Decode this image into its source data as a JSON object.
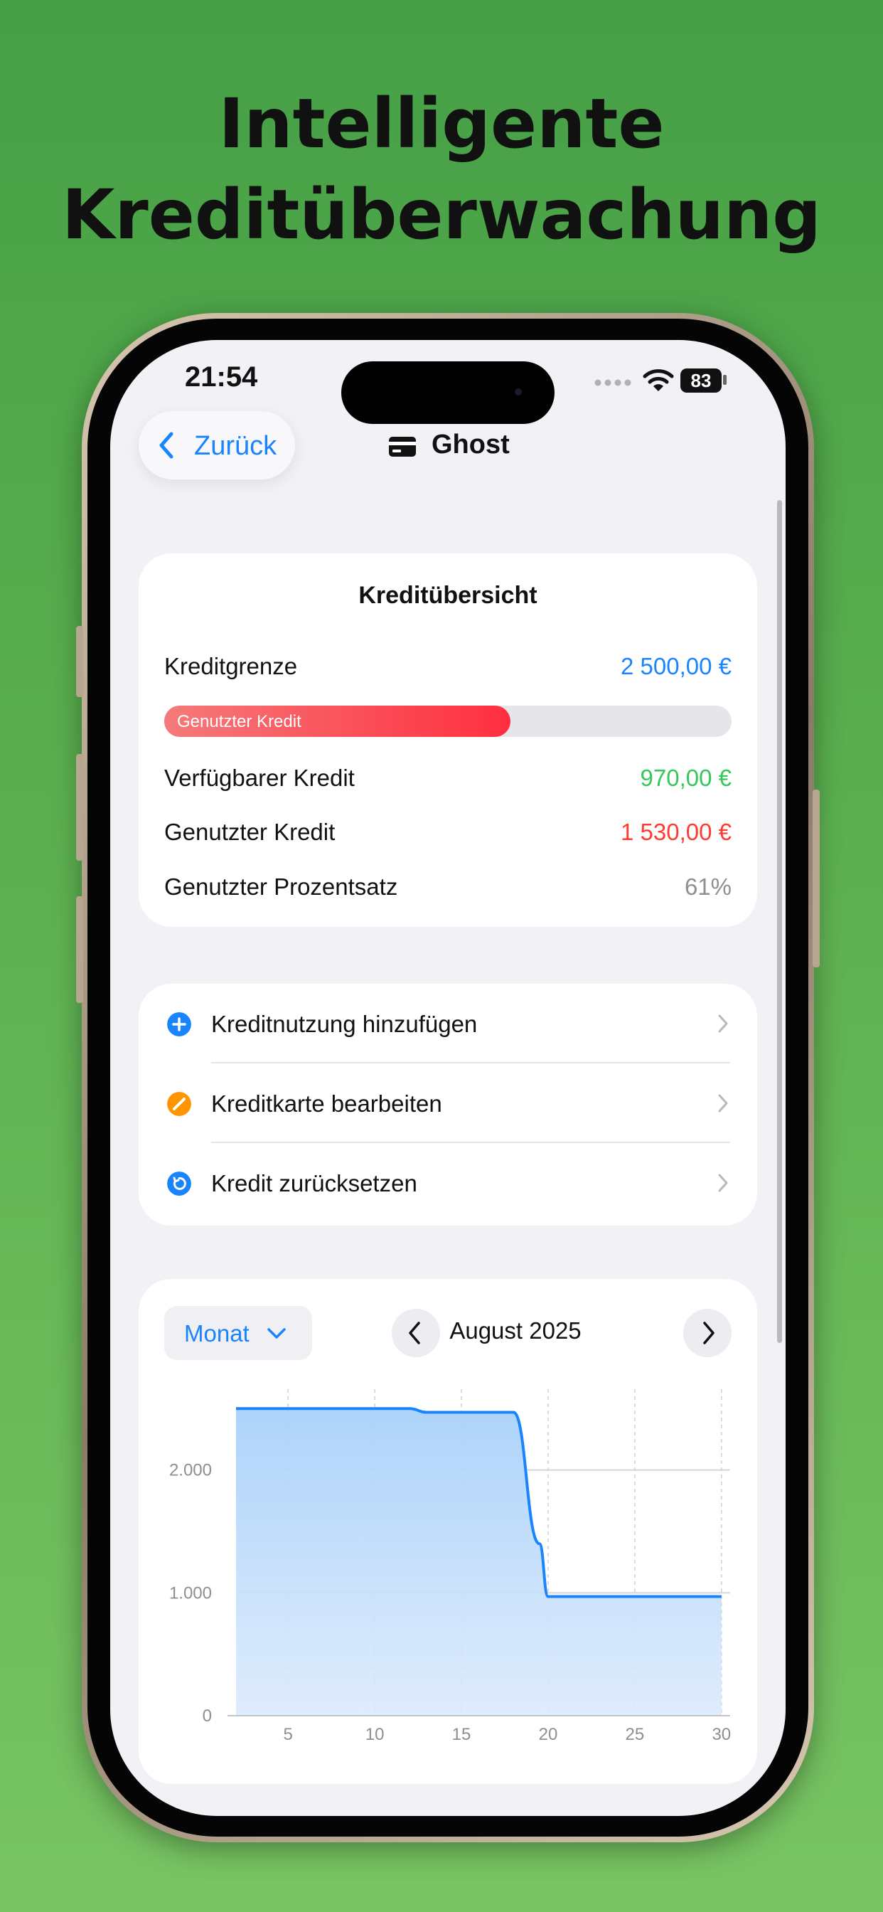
{
  "headline": [
    "Intelligente",
    "Kreditüberwachung"
  ],
  "status_bar": {
    "time": "21:54",
    "battery": "83"
  },
  "nav": {
    "back_label": "Zurück",
    "title": "Ghost",
    "title_icon": "credit-card-icon"
  },
  "overview": {
    "title": "Kreditübersicht",
    "credit_limit_label": "Kreditgrenze",
    "credit_limit_value": "2 500,00 €",
    "usage_bar_label": "Genutzter Kredit",
    "usage_fraction": 0.61,
    "available_label": "Verfügbarer Kredit",
    "available_value": "970,00 €",
    "used_label": "Genutzter Kredit",
    "used_value": "1 530,00 €",
    "percent_label": "Genutzter Prozentsatz",
    "percent_value": "61%"
  },
  "actions": [
    {
      "label": "Kreditnutzung hinzufügen",
      "icon": "plus-circle-icon",
      "color": "#1a84ff"
    },
    {
      "label": "Kreditkarte bearbeiten",
      "icon": "pencil-circle-icon",
      "color": "#ff9500"
    },
    {
      "label": "Kredit zurücksetzen",
      "icon": "reset-circle-icon",
      "color": "#1a84ff"
    }
  ],
  "chart_controls": {
    "period_label": "Monat",
    "month_label": "August 2025"
  },
  "colors": {
    "accent": "#1a84ff",
    "positive": "#34c759",
    "negative": "#ff3b30",
    "muted": "#8e8e93"
  },
  "chart_data": {
    "type": "area",
    "x": [
      2,
      12,
      13,
      18,
      19.5,
      20,
      30
    ],
    "y": [
      2500,
      2500,
      2470,
      2470,
      1400,
      970,
      970
    ],
    "xlim": [
      2,
      30.5
    ],
    "ylim": [
      0,
      2600
    ],
    "xticks": [
      5,
      10,
      15,
      20,
      25,
      30
    ],
    "xtick_labels": [
      "5",
      "10",
      "15",
      "20",
      "25",
      "30"
    ],
    "yticks": [
      0,
      1000,
      2000
    ],
    "ytick_labels": [
      "0",
      "1.000",
      "2.000"
    ],
    "title": "",
    "xlabel": "",
    "ylabel": "",
    "grid": true
  }
}
